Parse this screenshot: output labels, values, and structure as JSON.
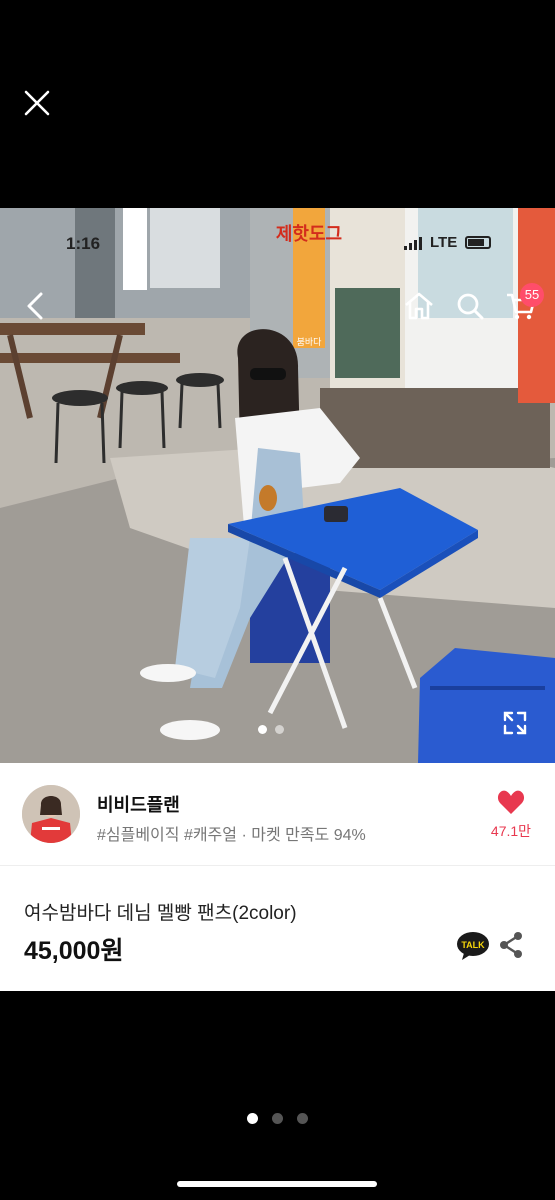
{
  "viewer": {
    "close_icon": "close-icon",
    "page_indicator": {
      "count": 3,
      "active_index": 0
    }
  },
  "status_bar": {
    "time": "1:16",
    "network": "LTE"
  },
  "top_nav": {
    "back_icon": "chevron-left-icon",
    "home_icon": "home-icon",
    "search_icon": "search-icon",
    "cart_icon": "cart-icon",
    "cart_badge": "55"
  },
  "photo": {
    "description_icon": "expand-icon",
    "carousel": {
      "count": 2,
      "active_index": 0
    },
    "shop_signs": [
      "제핫도그",
      "붐바다"
    ]
  },
  "store": {
    "name": "비비드플랜",
    "tags": "#심플베이직 #캐주얼 · 마켓 만족도 94%",
    "like_count": "47.1만"
  },
  "product": {
    "name": "여수밤바다 데님 멜빵 팬츠(2color)",
    "price": "45,000원",
    "talk_label": "TALK"
  },
  "colors": {
    "like": "#e8384f",
    "badge": "#ff4d6a",
    "table_blue": "#1f5fd6",
    "talk_yellow": "#f5d50a"
  }
}
